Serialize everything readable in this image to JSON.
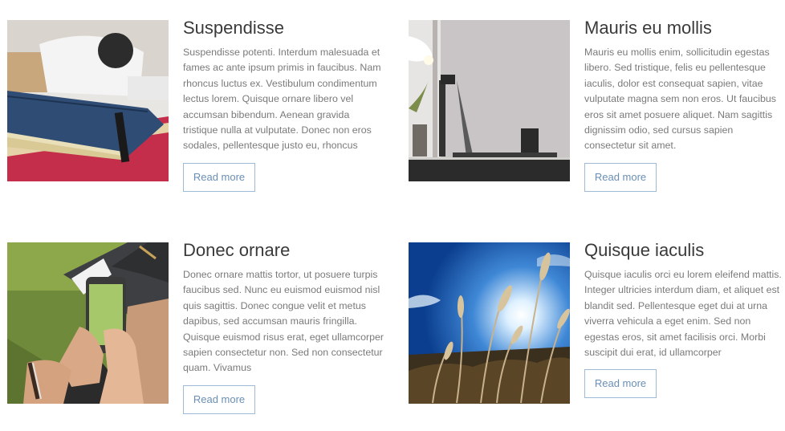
{
  "posts": [
    {
      "title": "Suspendisse",
      "excerpt": "Suspendisse potenti. Interdum malesuada et fames ac ante ipsum primis in faucibus. Nam rhoncus luctus ex. Vestibulum condimentum lectus lorem. Quisque ornare libero vel accumsan bibendum. Aenean gravida tristique nulla at vulputate. Donec non eros sodales, pellentesque justo eu, rhoncus",
      "button": "Read more"
    },
    {
      "title": "Mauris eu mollis",
      "excerpt": "Mauris eu mollis enim, sollicitudin egestas libero. Sed tristique, felis eu pellentesque iaculis, dolor est consequat sapien, vitae vulputate magna sem non eros. Ut faucibus eros sit amet posuere aliquet. Nam sagittis dignissim odio, sed cursus sapien consectetur sit amet.",
      "button": "Read more"
    },
    {
      "title": "Donec ornare",
      "excerpt": "Donec ornare mattis tortor, ut posuere turpis faucibus sed. Nunc eu euismod euismod nisl quis sagittis. Donec congue velit et metus dapibus, sed accumsan mauris fringilla. Quisque euismod risus erat, eget ullamcorper sapien consectetur non. Sed non consectetur quam. Vivamus",
      "button": "Read more"
    },
    {
      "title": "Quisque iaculis",
      "excerpt": "Quisque iaculis orci eu lorem eleifend mattis. Integer ultricies interdum diam, et aliquet est blandit sed. Pellentesque eget dui at urna viverra vehicula a eget enim. Sed non egestas eros, sit amet facilisis orci. Morbi suscipit dui erat, id ullamcorper",
      "button": "Read more"
    }
  ],
  "colors": {
    "title": "#3a3a3a",
    "text": "#7a7a7a",
    "button_border": "#9fbad6",
    "button_text": "#6a8fb5"
  }
}
